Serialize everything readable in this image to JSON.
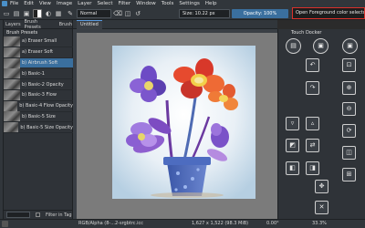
{
  "menubar": {
    "items": [
      "File",
      "Edit",
      "View",
      "Image",
      "Layer",
      "Select",
      "Filter",
      "Window",
      "Tools",
      "Settings",
      "Help"
    ]
  },
  "toolbar": {
    "blend_mode": "Normal",
    "brush_size": "Size: 10.22 px",
    "opacity": "Opacity: 100%",
    "opacity_fraction": 1.0
  },
  "tooltip": {
    "text": "Open Foreground color selector"
  },
  "brush_docker": {
    "tabs": [
      "Layers",
      "Brush Presets",
      "Brush"
    ],
    "title": "Brush Presets",
    "presets": [
      {
        "label": "a) Eraser Small",
        "selected": false
      },
      {
        "label": "a) Eraser Soft",
        "selected": false
      },
      {
        "label": "b) Airbrush Soft",
        "selected": true
      },
      {
        "label": "b) Basic-1",
        "selected": false
      },
      {
        "label": "b) Basic-2 Opacity",
        "selected": false
      },
      {
        "label": "b) Basic-3 Flow",
        "selected": false
      },
      {
        "label": "b) Basic-4 Flow Opacity",
        "selected": false
      },
      {
        "label": "b) Basic-5 Size",
        "selected": false
      },
      {
        "label": "b) Basic-5 Size Opacity",
        "selected": false
      }
    ],
    "filter_label": "Filter in Tag"
  },
  "canvas": {
    "tab_title": "Untitled"
  },
  "touch_docker": {
    "title": "Touch Docker"
  },
  "statusbar": {
    "color_profile": "RGB/Alpha (8-...2-srgbtrc.icc",
    "dimensions": "1,627 x 1,522 (98.3 MiB)",
    "rotation": "0.00°",
    "zoom": "33.3%"
  },
  "colors": {
    "accent": "#3a6f9e",
    "tooltip_border": "#d9312b",
    "panel_bg": "#2f3338"
  }
}
